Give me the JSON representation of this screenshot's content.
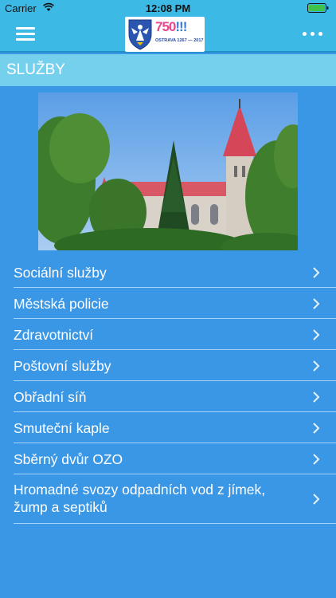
{
  "status_bar": {
    "carrier": "Carrier",
    "time": "12:08 PM"
  },
  "header": {
    "logo": {
      "number": "750",
      "exclaim": "!!!",
      "city": "OSTRAVA",
      "years": "1267 — 2017"
    }
  },
  "section": {
    "title": "SLUŽBY"
  },
  "menu": {
    "items": [
      {
        "label": "Sociální služby"
      },
      {
        "label": "Městská policie"
      },
      {
        "label": "Zdravotnictví"
      },
      {
        "label": "Poštovní služby"
      },
      {
        "label": "Obřadní síň"
      },
      {
        "label": "Smuteční kaple"
      },
      {
        "label": "Sběrný dvůr OZO"
      },
      {
        "label": "Hromadné svozy odpadních vod z jímek, žump a septiků"
      }
    ]
  },
  "colors": {
    "bar": "#3db9e6",
    "section": "#75d0ee",
    "background": "#3a97e6"
  },
  "icons": [
    "wifi-icon",
    "battery-icon",
    "menu-icon",
    "more-icon",
    "chevron-right-icon"
  ]
}
